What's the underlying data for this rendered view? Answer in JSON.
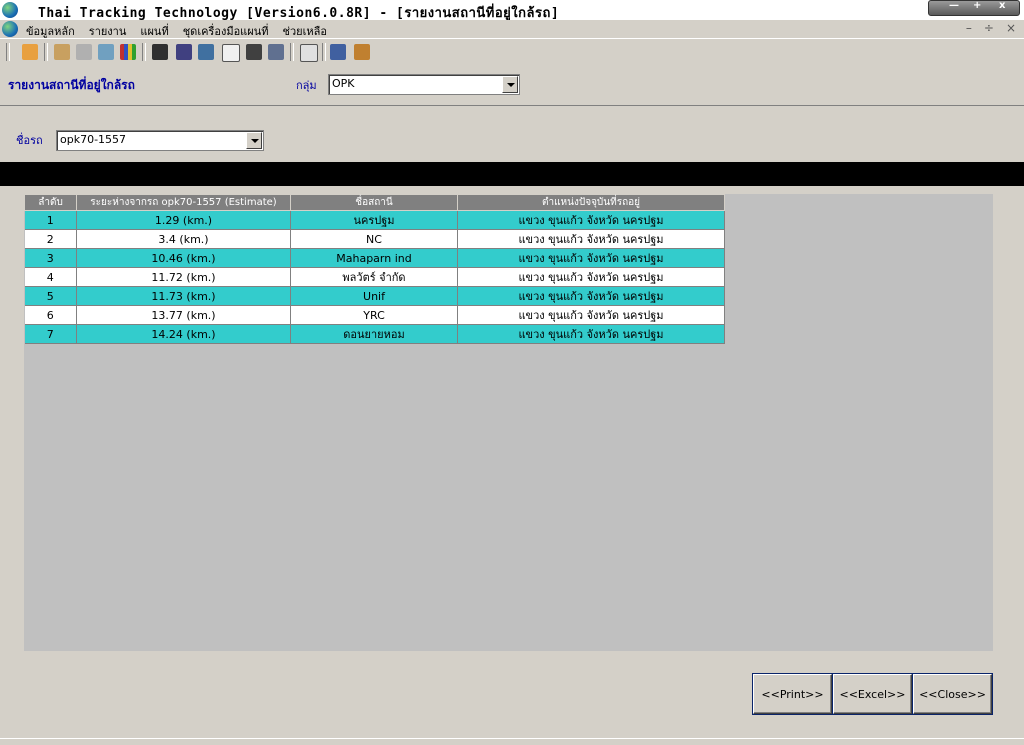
{
  "window": {
    "title": "Thai Tracking Technology [Version6.0.8R] - [รายงานสถานีที่อยู่ใกล้รถ]"
  },
  "menu": {
    "items": [
      "ข้อมูลหลัก",
      "รายงาน",
      "แผนที่",
      "ชุดเครื่องมือแผนที่",
      "ช่วยเหลือ"
    ]
  },
  "toolbar": {
    "icons": [
      "hand-icon",
      "users-icon",
      "route-icon",
      "tools-icon",
      "bar-chart-icon",
      "report-icon",
      "table-icon",
      "chart-icon",
      "form-icon",
      "map-icon",
      "find-icon",
      "zoom-icon",
      "export-icon",
      "exit-icon"
    ]
  },
  "header": {
    "page_title": "รายงานสถานีที่อยู่ใกล้รถ",
    "group_label": "กลุ่ม",
    "group_value": "OPK"
  },
  "filter": {
    "car_label": "ชื่อรถ",
    "car_value": "opk70-1557"
  },
  "table": {
    "columns": [
      "ลำดับ",
      "ระยะห่างจากรถ   opk70-1557  (Estimate)",
      "ชื่อสถานี",
      "ตำแหน่งปัจจุบันที่รถอยู่"
    ],
    "rows": [
      [
        "1",
        "1.29 (km.)",
        "นครปฐม",
        "แขวง ขุนแก้ว  จังหวัด นครปฐม"
      ],
      [
        "2",
        "3.4 (km.)",
        "NC",
        "แขวง ขุนแก้ว  จังหวัด นครปฐม"
      ],
      [
        "3",
        "10.46 (km.)",
        "Mahaparn ind",
        "แขวง ขุนแก้ว  จังหวัด นครปฐม"
      ],
      [
        "4",
        "11.72 (km.)",
        "พลวัตร์ จำกัด",
        "แขวง ขุนแก้ว  จังหวัด นครปฐม"
      ],
      [
        "5",
        "11.73 (km.)",
        "Unif",
        "แขวง ขุนแก้ว  จังหวัด นครปฐม"
      ],
      [
        "6",
        "13.77 (km.)",
        "YRC",
        "แขวง ขุนแก้ว  จังหวัด นครปฐม"
      ],
      [
        "7",
        "14.24 (km.)",
        "ดอนยายหอม",
        "แขวง ขุนแก้ว  จังหวัด นครปฐม"
      ]
    ]
  },
  "buttons": {
    "print": "<<Print>>",
    "excel": "<<Excel>>",
    "close": "<<Close>>"
  },
  "colors": {
    "row_highlight": "#33cccc",
    "header_bg": "#808080",
    "title_text": "#0000a0"
  }
}
